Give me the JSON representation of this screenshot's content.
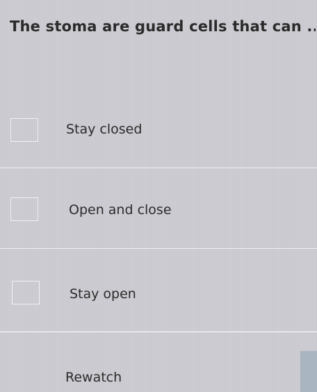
{
  "question": {
    "text": "The stoma are guard cells that can .."
  },
  "options": [
    {
      "label": "Stay closed",
      "checked": false
    },
    {
      "label": "Open and close",
      "checked": false
    },
    {
      "label": "Stay open",
      "checked": false
    }
  ],
  "footer": {
    "rewatch_label": "Rewatch"
  },
  "colors": {
    "background": "#c9c9cf",
    "divider": "#f0f0f2",
    "checkbox_border": "#f2f2f4",
    "side_tab": "#aab5c2"
  }
}
